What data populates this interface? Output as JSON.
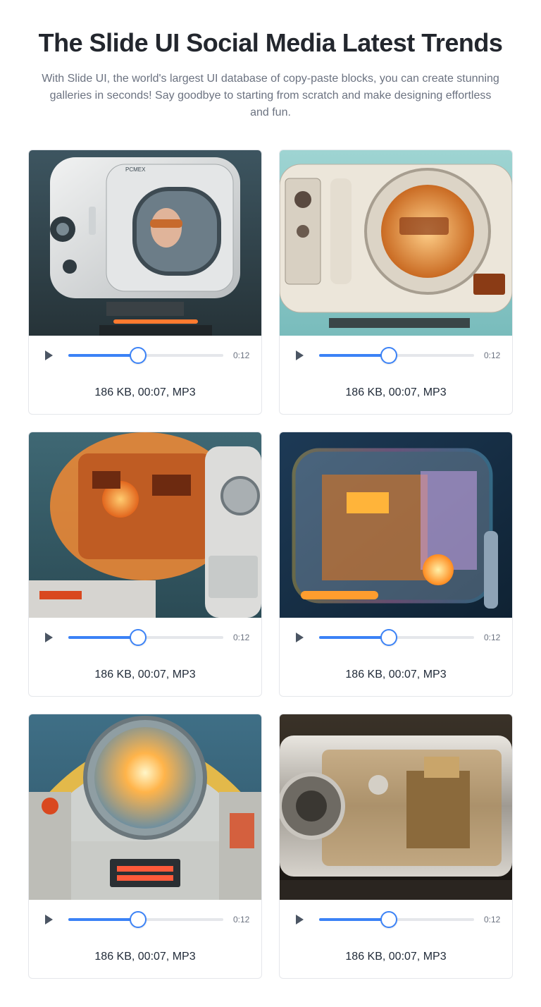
{
  "header": {
    "title": "The Slide UI Social Media Latest Trends",
    "subtitle": "With Slide UI, the world's largest UI database of copy-paste blocks, you can create stunning galleries in seconds! Say goodbye to starting from scratch and make designing effortless and fun."
  },
  "colors": {
    "accent": "#3b82f6",
    "track": "#e5e7eb",
    "heading": "#23272e",
    "muted": "#6b7280"
  },
  "cards": [
    {
      "image_icon": "retro-tv-robot-image",
      "time": "0:12",
      "progress": 0.45,
      "meta": "186 KB, 00:07, MP3"
    },
    {
      "image_icon": "retro-washer-robot-image",
      "time": "0:12",
      "progress": 0.45,
      "meta": "186 KB, 00:07, MP3"
    },
    {
      "image_icon": "orange-glass-robot-image",
      "time": "0:12",
      "progress": 0.45,
      "meta": "186 KB, 00:07, MP3"
    },
    {
      "image_icon": "neon-glass-machine-image",
      "time": "0:12",
      "progress": 0.45,
      "meta": "186 KB, 00:07, MP3"
    },
    {
      "image_icon": "jukebox-dome-image",
      "time": "0:12",
      "progress": 0.45,
      "meta": "186 KB, 00:07, MP3"
    },
    {
      "image_icon": "chrome-engine-case-image",
      "time": "0:12",
      "progress": 0.45,
      "meta": "186 KB, 00:07, MP3"
    }
  ]
}
